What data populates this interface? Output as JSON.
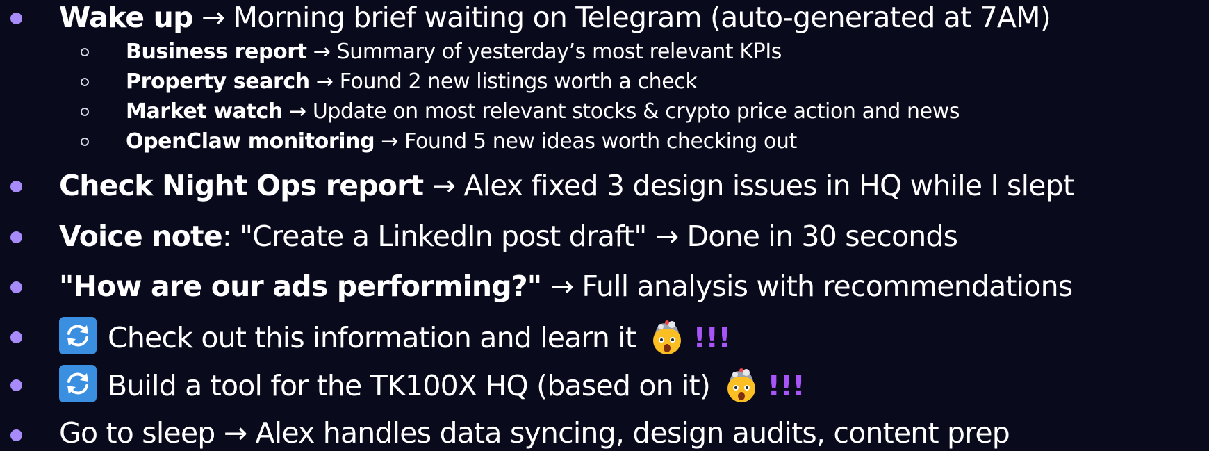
{
  "items": [
    {
      "bold": "Wake up",
      "rest": " → Morning brief waiting on Telegram (auto-generated at 7AM)",
      "subitems": [
        {
          "bold": "Business report",
          "rest": " → Summary of yesterday’s most relevant KPIs"
        },
        {
          "bold": "Property search",
          "rest": " → Found 2 new listings worth a check"
        },
        {
          "bold": "Market watch",
          "rest": " → Update on most relevant stocks & crypto price action and news"
        },
        {
          "bold": "OpenClaw monitoring",
          "rest": " → Found 5 new ideas worth checking out"
        }
      ]
    },
    {
      "bold": "Check Night Ops report",
      "rest": " → Alex fixed 3 design issues in HQ while I slept"
    },
    {
      "bold": "Voice note",
      "rest": ": \"Create a LinkedIn post draft\" → Done in 30 seconds"
    },
    {
      "bold": "\"How are our ads performing?\"",
      "rest": " → Full analysis with recommendations"
    },
    {
      "text": "Check out this information and learn it",
      "icon": "repeat-arrows-icon",
      "emoji": "exploding-head-icon",
      "exclaim": "!!!"
    },
    {
      "text": "Build a tool for the TK100X HQ (based on it)",
      "icon": "repeat-arrows-icon",
      "emoji": "exploding-head-icon",
      "exclaim": "!!!"
    },
    {
      "text": "Go to sleep → Alex handles data syncing, design audits, content prep"
    }
  ],
  "colors": {
    "background": "#090b1d",
    "bullet": "#a78bfa",
    "exclaim": "#a855f7",
    "text": "#ffffff"
  }
}
